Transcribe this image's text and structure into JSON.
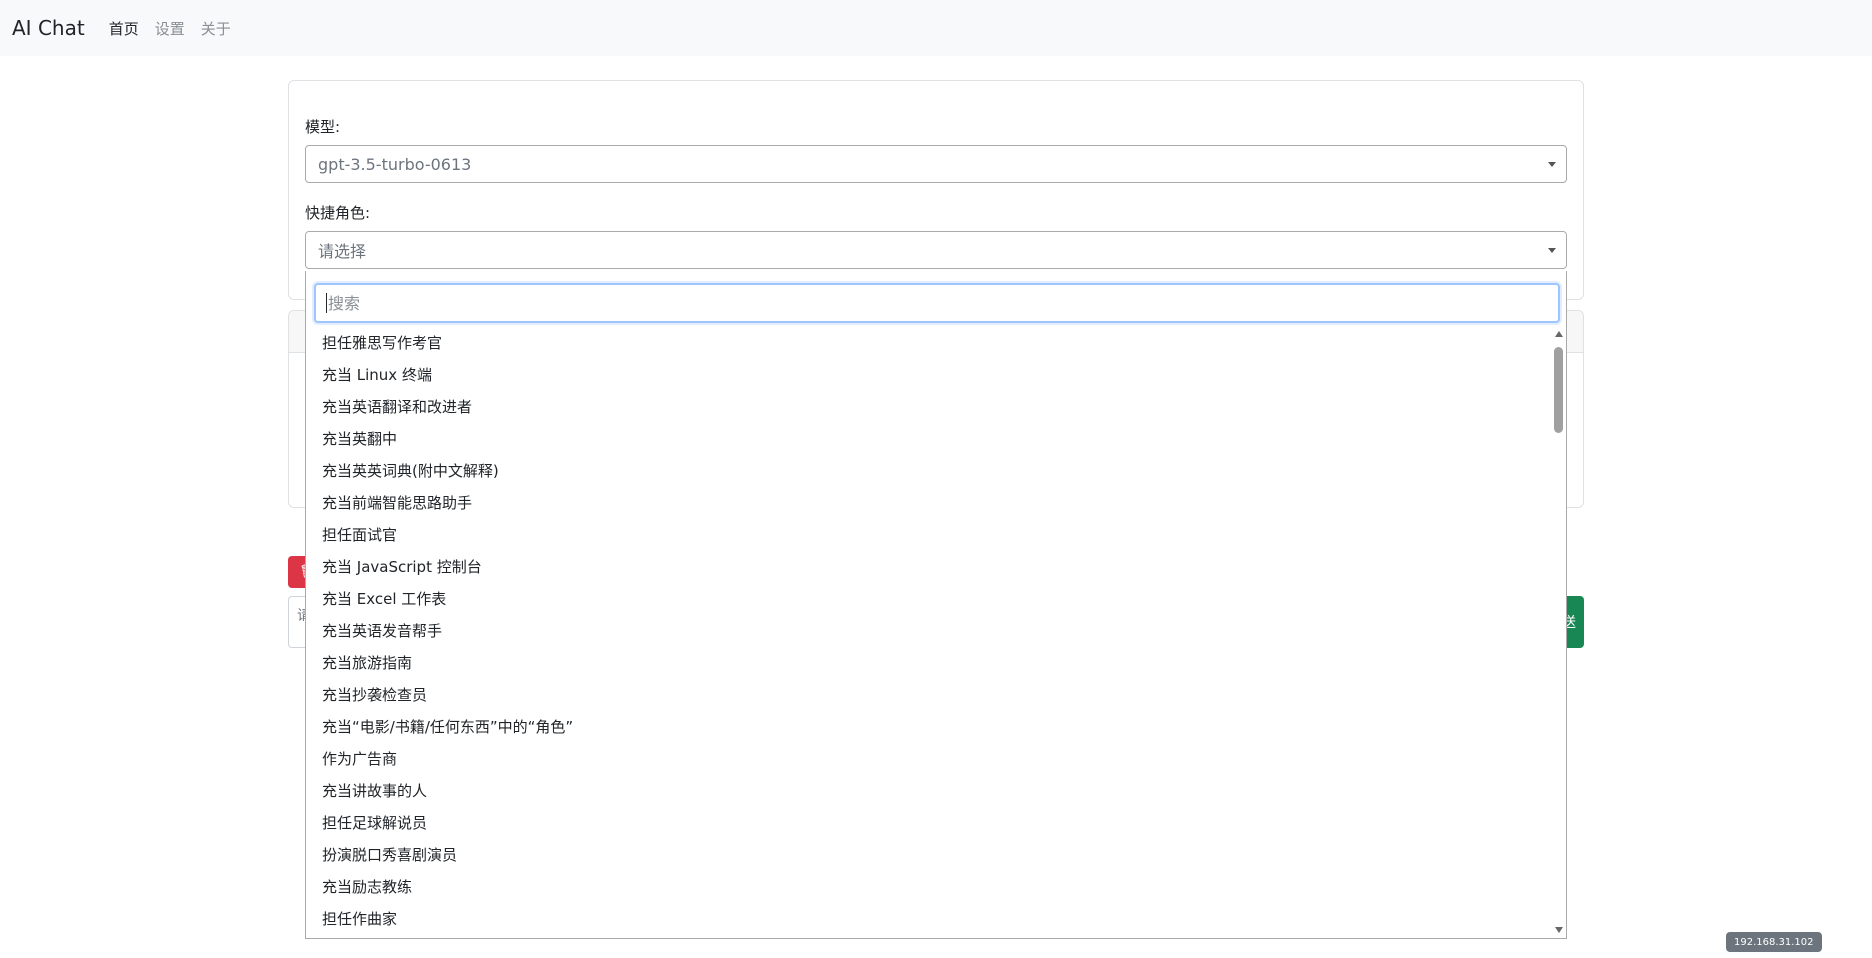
{
  "navbar": {
    "brand": "AI Chat",
    "links": [
      {
        "label": "首页",
        "active": true
      },
      {
        "label": "设置",
        "active": false
      },
      {
        "label": "关于",
        "active": false
      }
    ]
  },
  "config": {
    "model_label": "模型:",
    "model_value": "gpt-3.5-turbo-0613",
    "role_label": "快捷角色:",
    "role_placeholder": "请选择"
  },
  "chat": {
    "clear_icon": "trash-icon",
    "input_placeholder_fragment": "请",
    "send_label_fragment": "送"
  },
  "dropdown": {
    "search_placeholder": "搜索",
    "options": [
      "担任雅思写作考官",
      "充当 Linux 终端",
      "充当英语翻译和改进者",
      "充当英翻中",
      "充当英英词典(附中文解释)",
      "充当前端智能思路助手",
      "担任面试官",
      "充当 JavaScript 控制台",
      "充当 Excel 工作表",
      "充当英语发音帮手",
      "充当旅游指南",
      "充当抄袭检查员",
      "充当“电影/书籍/任何东西”中的“角色”",
      "作为广告商",
      "充当讲故事的人",
      "担任足球解说员",
      "扮演脱口秀喜剧演员",
      "充当励志教练",
      "担任作曲家"
    ]
  },
  "status": {
    "ip": "192.168.31.102"
  },
  "colors": {
    "danger": "#dc3545",
    "success": "#198754",
    "focus": "#9ec5fe"
  }
}
